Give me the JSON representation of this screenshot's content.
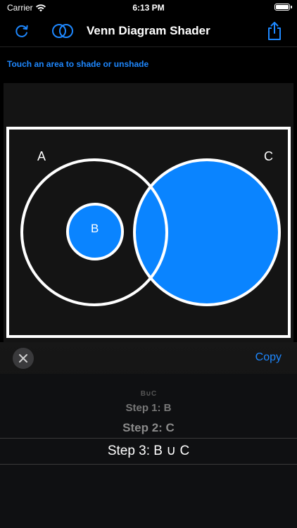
{
  "status": {
    "carrier": "Carrier",
    "time": "6:13 PM"
  },
  "nav": {
    "title": "Venn Diagram Shader",
    "refresh_icon": "refresh-icon",
    "venn_icon": "two-circles-icon",
    "share_icon": "share-icon"
  },
  "instruction": "Touch an area to shade or unshade",
  "diagram": {
    "label_a": "A",
    "label_b": "B",
    "label_c": "C",
    "shade_color": "#0a84ff"
  },
  "actions": {
    "copy": "Copy",
    "clear_icon": "close-icon"
  },
  "steps": {
    "header": "B∪C",
    "step1": "Step 1: B",
    "step2": "Step 2: C",
    "step3": "Step 3: B ∪ C"
  },
  "colors": {
    "accent": "#1e88ff",
    "background": "#000000"
  }
}
